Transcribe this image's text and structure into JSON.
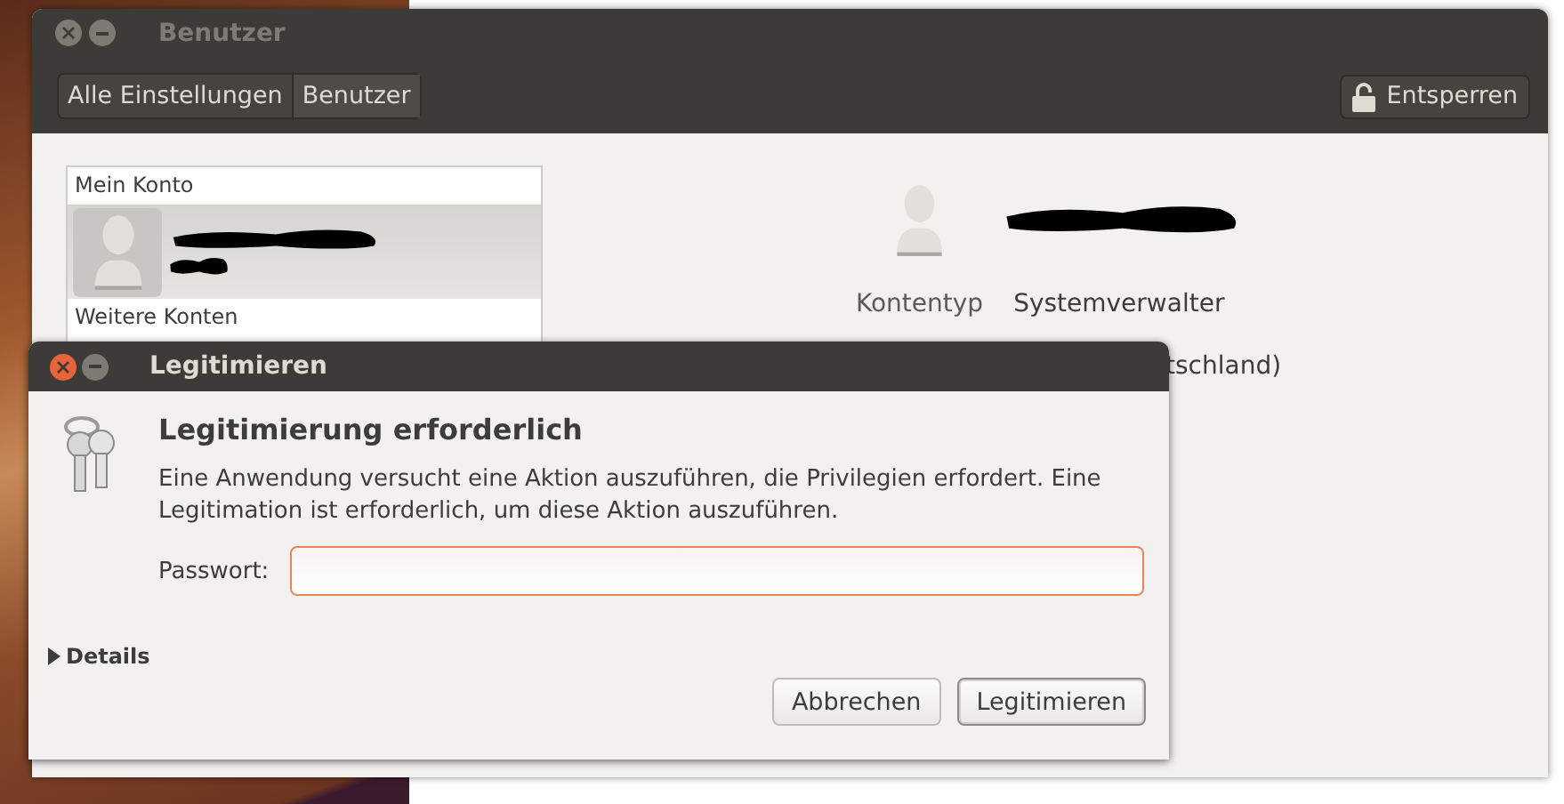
{
  "main_window": {
    "title": "Benutzer",
    "breadcrumbs": [
      {
        "label": "Alle Einstellungen",
        "selected": false
      },
      {
        "label": "Benutzer",
        "selected": true
      }
    ],
    "unlock_button": "Entsperren",
    "account_list": {
      "sections": [
        {
          "header": "Mein Konto",
          "accounts": [
            {
              "kind": "redacted",
              "selected": true
            }
          ]
        },
        {
          "header": "Weitere Konten"
        }
      ]
    },
    "details": {
      "rows": [
        {
          "label": "Kontentyp",
          "value": "Systemverwalter"
        }
      ],
      "partial_text": "tschland)"
    }
  },
  "dialog": {
    "title": "Legitimieren",
    "heading": "Legitimierung erforderlich",
    "message": "Eine Anwendung versucht eine Aktion auszuführen, die Privilegien erfordert. Eine Legitimation ist erforderlich, um diese Aktion auszuführen.",
    "password_label": "Passwort:",
    "details": {
      "label": "Details",
      "expanded": false
    },
    "buttons": [
      {
        "label": "Abbrechen",
        "default": false
      },
      {
        "label": "Legitimieren",
        "default": true
      }
    ]
  }
}
